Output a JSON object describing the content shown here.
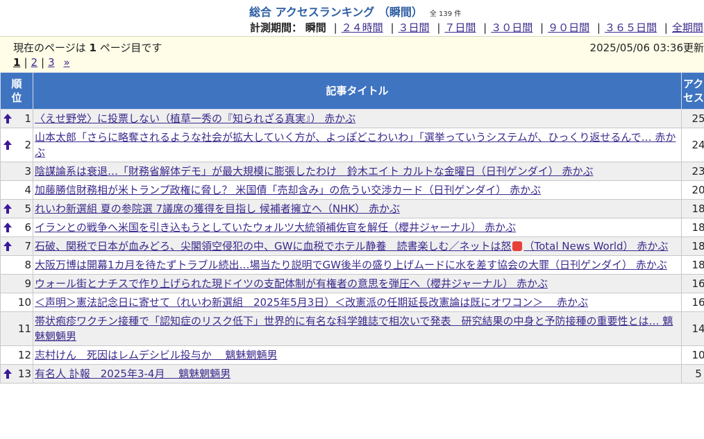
{
  "header": {
    "title": "総合 アクセスランキング （瞬間）",
    "count": "全 139 件",
    "period_label": "計測期間：",
    "period_current": "瞬間",
    "periods": [
      "２４時間",
      "３日間",
      "７日間",
      "３０日間",
      "９０日間",
      "３６５日間",
      "全期間"
    ]
  },
  "info": {
    "page_msg_prefix": "現在のページは ",
    "page_num": "1",
    "page_msg_suffix": " ページ目です",
    "updated": "2025/05/06 03:36更新",
    "pager": {
      "current": "1",
      "pages": [
        "2",
        "3"
      ],
      "next": "»"
    }
  },
  "table": {
    "col_rank": "順位",
    "col_title": "記事タイトル",
    "col_access": "アクセス",
    "rows": [
      {
        "rank": "1",
        "up": true,
        "title": "〈えせ野党〉に投票しない（植草一秀の『知られざる真実』） 赤かぶ",
        "access": "25"
      },
      {
        "rank": "2",
        "up": true,
        "title": "山本太郎「さらに略奪されるような社会が拡大していく方が、よっぽどこわいわ」「選挙っていうシステムが、ひっくり返せるんで… 赤かぶ",
        "access": "24"
      },
      {
        "rank": "3",
        "up": false,
        "title": "陰謀論系は衰退…「財務省解体デモ」が最大規模に膨張したわけ　鈴木エイト カルトな金曜日（日刊ゲンダイ） 赤かぶ",
        "access": "23"
      },
      {
        "rank": "4",
        "up": false,
        "title": "加藤勝信財務相が米トランプ政権に脅し？ 米国債「売却含み」の危うい交渉カード（日刊ゲンダイ） 赤かぶ",
        "access": "20"
      },
      {
        "rank": "5",
        "up": true,
        "title": "れいわ新選組 夏の参院選 7議席の獲得を目指し 候補者擁立へ（NHK） 赤かぶ",
        "access": "18"
      },
      {
        "rank": "6",
        "up": true,
        "title": "イランとの戦争へ米国を引き込もうとしていたウォルツ大統領補佐官を解任（櫻井ジャーナル） 赤かぶ",
        "access": "18"
      },
      {
        "rank": "7",
        "up": true,
        "title_a": "石破、関税で日本が血みどろ、尖閣領空侵犯の中、GWに血税でホテル静養　読書楽しむ／ネットは怒",
        "title_b": "（Total News World） 赤かぶ",
        "access": "18"
      },
      {
        "rank": "8",
        "up": false,
        "title": "大阪万博は開幕1カ月を待たずトラブル続出…場当たり説明でGW後半の盛り上げムードに水を差す協会の大罪（日刊ゲンダイ） 赤かぶ",
        "access": "18"
      },
      {
        "rank": "9",
        "up": false,
        "title": "ウォール街とナチスで作り上げられた現ドイツの支配体制が有権者の意思を弾圧へ（櫻井ジャーナル） 赤かぶ",
        "access": "16"
      },
      {
        "rank": "10",
        "up": false,
        "title": "＜声明＞憲法記念日に寄せて（れいわ新選組　2025年5月3日）＜改憲派の任期延長改憲論は既にオワコン＞　 赤かぶ",
        "access": "16"
      },
      {
        "rank": "11",
        "up": false,
        "title": "帯状疱疹ワクチン接種で「認知症のリスク低下」世界的に有名な科学雑誌で相次いで発表　研究結果の中身と予防接種の重要性とは… 魑魅魍魎男",
        "access": "14"
      },
      {
        "rank": "12",
        "up": false,
        "title": "志村けん　死因はレムデシビル投与か　 魑魅魍魎男",
        "access": "10"
      },
      {
        "rank": "13",
        "up": true,
        "title": "有名人 訃報　2025年3-4月　 魑魅魍魎男",
        "access": "5"
      }
    ]
  },
  "colors": {
    "header_blue": "#3f74c1",
    "title_blue": "#2e5fa3",
    "link": "#3c2a8c",
    "arrow": "#3a1a9a",
    "info_bg": "#fffde8"
  },
  "icons": {
    "rank_up": "rank-up-arrow-icon",
    "anger": "anger-emoji-icon"
  }
}
